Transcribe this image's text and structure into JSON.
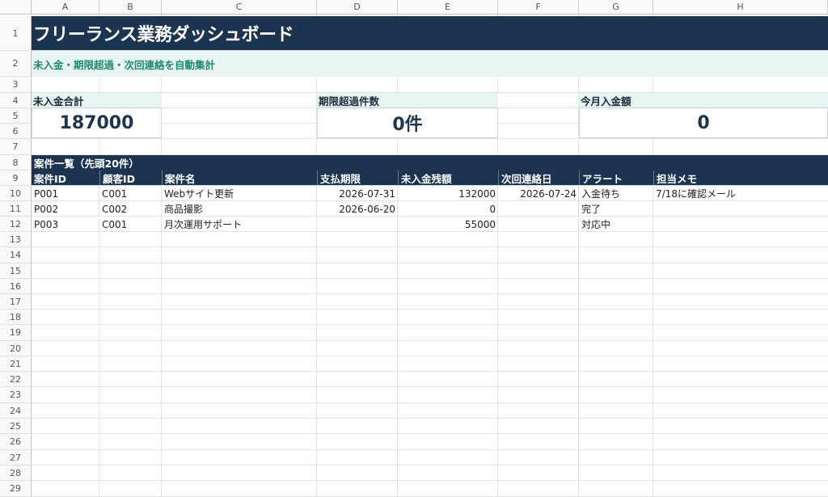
{
  "columns": [
    "A",
    "B",
    "C",
    "D",
    "E",
    "F",
    "G",
    "H"
  ],
  "rows": [
    "1",
    "2",
    "3",
    "4",
    "5",
    "6",
    "7",
    "8",
    "9",
    "10",
    "11",
    "12",
    "13",
    "14",
    "15",
    "16",
    "17",
    "18",
    "19",
    "20",
    "21",
    "22",
    "23",
    "24",
    "25",
    "26",
    "27",
    "28",
    "29"
  ],
  "title": "フリーランス業務ダッシュボード",
  "subtitle": "未入金・期限超過・次回連絡を自動集計",
  "kpis": [
    {
      "label": "未入金合計",
      "value": "187000"
    },
    {
      "label": "期限超過件数",
      "value": "0件"
    },
    {
      "label": "今月入金額",
      "value": "0"
    }
  ],
  "section_title": "案件一覧（先頭20件）",
  "table": {
    "headers": [
      "案件ID",
      "顧客ID",
      "案件名",
      "支払期限",
      "未入金残額",
      "次回連絡日",
      "アラート",
      "担当メモ"
    ],
    "rows": [
      [
        "P001",
        "C001",
        "Webサイト更新",
        "2026-07-31",
        "132000",
        "2026-07-24",
        "入金待ち",
        "7/18に確認メール"
      ],
      [
        "P002",
        "C002",
        "商品撮影",
        "2026-06-20",
        "0",
        "",
        "完了",
        ""
      ],
      [
        "P003",
        "C001",
        "月次運用サポート",
        "",
        "55000",
        "",
        "対応中",
        ""
      ]
    ]
  },
  "colors": {
    "navy": "#1b3551",
    "mint": "#e7f4f2",
    "teal_text": "#1d8a6e"
  }
}
